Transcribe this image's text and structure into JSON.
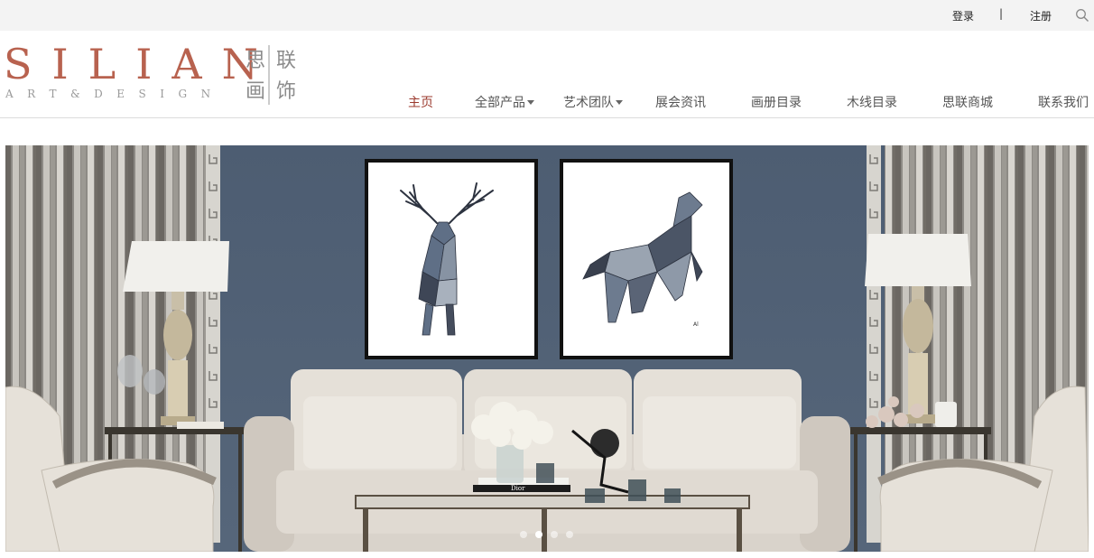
{
  "topbar": {
    "login": "登录",
    "separator": "|",
    "register": "注册",
    "search_icon": "search-icon"
  },
  "logo": {
    "wordmark": "SILIAN",
    "subtitle": "ART&DESIGN",
    "chars": [
      "思",
      "联",
      "画",
      "饰"
    ],
    "color": "#b8624f"
  },
  "nav": {
    "items": [
      {
        "label": "主页",
        "active": true
      },
      {
        "label": "全部产品",
        "dropdown": true
      },
      {
        "label": "艺术团队",
        "dropdown": true
      },
      {
        "label": "展会资讯"
      },
      {
        "label": "画册目录"
      },
      {
        "label": "木线目录"
      },
      {
        "label": "思联商城"
      },
      {
        "label": "联系我们"
      }
    ],
    "active_color": "#9b3a2e"
  },
  "hero": {
    "slides": 4,
    "active_slide": 2,
    "book_text": "Dior"
  }
}
